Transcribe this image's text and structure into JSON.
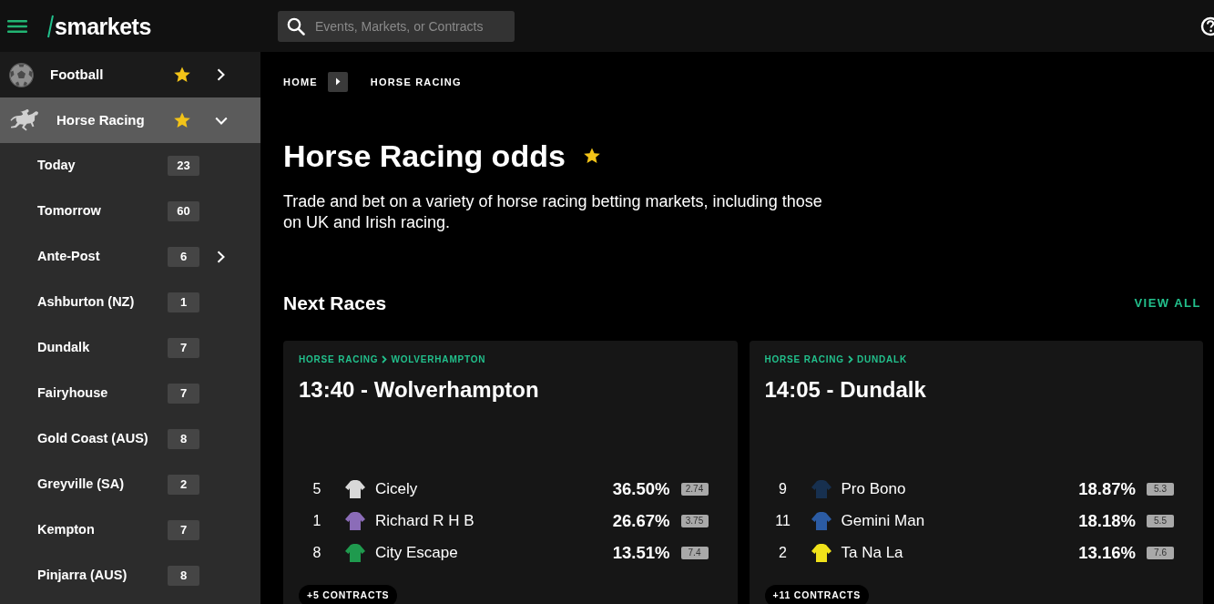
{
  "header": {
    "logo": "smarkets",
    "search": {
      "placeholder": "Events, Markets, or Contracts"
    }
  },
  "sidebar": {
    "sports": [
      {
        "kind": "football",
        "label": "Football",
        "starred": true,
        "selected": false,
        "expanded": false
      },
      {
        "kind": "horse",
        "label": "Horse Racing",
        "starred": true,
        "selected": true,
        "expanded": true,
        "children": [
          {
            "label": "Today",
            "count": "23",
            "has_submenu": false
          },
          {
            "label": "Tomorrow",
            "count": "60",
            "has_submenu": false
          },
          {
            "label": "Ante-Post",
            "count": "6",
            "has_submenu": true
          },
          {
            "label": "Ashburton (NZ)",
            "count": "1",
            "has_submenu": false
          },
          {
            "label": "Dundalk",
            "count": "7",
            "has_submenu": false
          },
          {
            "label": "Fairyhouse",
            "count": "7",
            "has_submenu": false
          },
          {
            "label": "Gold Coast (AUS)",
            "count": "8",
            "has_submenu": false
          },
          {
            "label": "Greyville (SA)",
            "count": "2",
            "has_submenu": false
          },
          {
            "label": "Kempton",
            "count": "7",
            "has_submenu": false
          },
          {
            "label": "Pinjarra (AUS)",
            "count": "8",
            "has_submenu": false
          }
        ]
      }
    ]
  },
  "breadcrumb": [
    "HOME",
    "HORSE RACING"
  ],
  "page": {
    "title": "Horse Racing odds",
    "starred": true,
    "description": "Trade and bet on a variety of horse racing betting markets, including those on UK and Irish racing."
  },
  "next_races": {
    "title": "Next Races",
    "view_all": "VIEW ALL",
    "races": [
      {
        "path": [
          "HORSE RACING",
          "WOLVERHAMPTON"
        ],
        "title": "13:40 - Wolverhampton",
        "runners": [
          {
            "number": "5",
            "name": "Cicely",
            "color": "#d8d8d8",
            "probability": "36.50%",
            "odds": "2.74"
          },
          {
            "number": "1",
            "name": "Richard R H B",
            "color": "#8b6cb8",
            "probability": "26.67%",
            "odds": "3.75"
          },
          {
            "number": "8",
            "name": "City Escape",
            "color": "#1f9a4e",
            "probability": "13.51%",
            "odds": "7.4"
          }
        ],
        "more": "+5 CONTRACTS"
      },
      {
        "path": [
          "HORSE RACING",
          "DUNDALK"
        ],
        "title": "14:05 - Dundalk",
        "runners": [
          {
            "number": "9",
            "name": "Pro Bono",
            "color": "#17304f",
            "probability": "18.87%",
            "odds": "5.3"
          },
          {
            "number": "11",
            "name": "Gemini Man",
            "color": "#2b5ba3",
            "probability": "18.18%",
            "odds": "5.5"
          },
          {
            "number": "2",
            "name": "Ta Na La",
            "color": "#f0e21a",
            "probability": "13.16%",
            "odds": "7.6"
          }
        ],
        "more": "+11 CONTRACTS"
      }
    ]
  }
}
